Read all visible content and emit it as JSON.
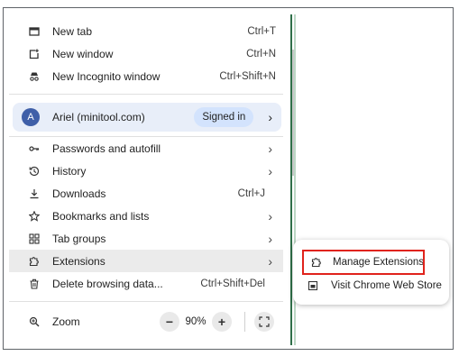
{
  "menu": {
    "top_items": [
      {
        "label": "New tab",
        "shortcut": "Ctrl+T",
        "icon": "new-tab-icon"
      },
      {
        "label": "New window",
        "shortcut": "Ctrl+N",
        "icon": "new-window-icon"
      },
      {
        "label": "New Incognito window",
        "shortcut": "Ctrl+Shift+N",
        "icon": "incognito-icon"
      }
    ],
    "profile": {
      "avatar_letter": "A",
      "name": "Ariel (minitool.com)",
      "status": "Signed in",
      "arrow": "›"
    },
    "items": [
      {
        "label": "Passwords and autofill",
        "shortcut": "",
        "arrow": "›",
        "icon": "key-icon"
      },
      {
        "label": "History",
        "shortcut": "",
        "arrow": "›",
        "icon": "history-icon"
      },
      {
        "label": "Downloads",
        "shortcut": "Ctrl+J",
        "arrow": "",
        "icon": "download-icon"
      },
      {
        "label": "Bookmarks and lists",
        "shortcut": "",
        "arrow": "›",
        "icon": "star-icon"
      },
      {
        "label": "Tab groups",
        "shortcut": "",
        "arrow": "›",
        "icon": "tab-groups-icon"
      },
      {
        "label": "Extensions",
        "shortcut": "",
        "arrow": "›",
        "icon": "extension-icon"
      },
      {
        "label": "Delete browsing data...",
        "shortcut": "Ctrl+Shift+Del",
        "arrow": "",
        "icon": "trash-icon"
      }
    ],
    "zoom": {
      "label": "Zoom",
      "minus": "−",
      "value": "90%",
      "plus": "+",
      "icon": "zoom-icon"
    }
  },
  "submenu": {
    "items": [
      {
        "label": "Manage Extensions",
        "icon": "extension-icon",
        "highlighted": true
      },
      {
        "label": "Visit Chrome Web Store",
        "icon": "web-store-icon",
        "highlighted": false
      }
    ]
  },
  "colors": {
    "highlight_box": "#e0231c",
    "profile_bg": "#e8eef9",
    "avatar_bg": "#3f5fa8",
    "hover_bg": "#ebebeb"
  }
}
